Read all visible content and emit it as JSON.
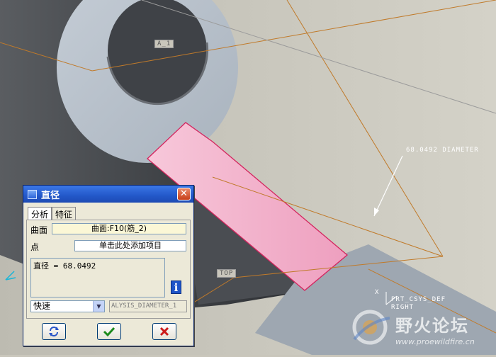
{
  "viewport": {
    "labels": {
      "axis_tag": "A_1",
      "diameter": "68.0492 DIAMETER",
      "top": "TOP",
      "csys": "PRT_CSYS_DEF",
      "right": "RIGHT",
      "x": "X"
    },
    "colors": {
      "background": "#c9c6bb",
      "highlight": "#f2a9c6",
      "datum": "#c07a2a"
    }
  },
  "dialog": {
    "title": "直径",
    "close_icon": "close-icon",
    "tabs": [
      {
        "label": "分析",
        "active": true
      },
      {
        "label": "特征",
        "active": false
      }
    ],
    "surface": {
      "label": "曲面",
      "value": "曲面:F10(筋_2)"
    },
    "point": {
      "label": "点",
      "value": "单击此处添加项目"
    },
    "result_text": "直径 = 68.0492",
    "mode_select": "快速",
    "analysis_name": "ALYSIS_DIAMETER_1",
    "buttons": {
      "repeat": "repeat-icon",
      "ok": "check-icon",
      "cancel": "x-icon"
    }
  },
  "watermark": {
    "site_name": "野火论坛",
    "url": "www.proewildfire.cn"
  }
}
